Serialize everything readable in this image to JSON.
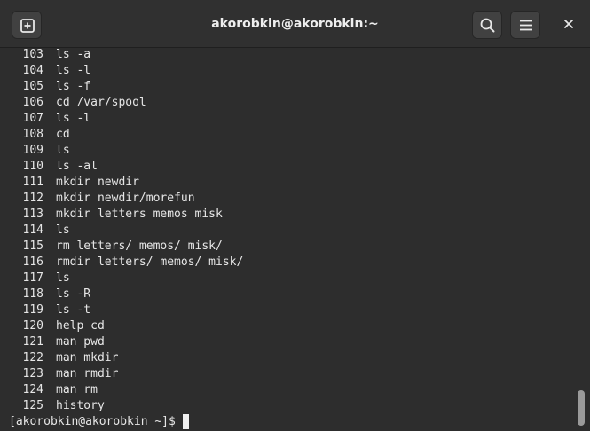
{
  "window": {
    "title": "akorobkin@akorobkin:~"
  },
  "header": {
    "new_tab_icon": "plus-square-icon",
    "search_icon": "search-icon",
    "menu_icon": "hamburger-menu-icon",
    "close_icon": "close-icon"
  },
  "history": [
    {
      "num": "103",
      "cmd": "ls -a"
    },
    {
      "num": "104",
      "cmd": "ls -l"
    },
    {
      "num": "105",
      "cmd": "ls -f"
    },
    {
      "num": "106",
      "cmd": "cd /var/spool"
    },
    {
      "num": "107",
      "cmd": "ls -l"
    },
    {
      "num": "108",
      "cmd": "cd"
    },
    {
      "num": "109",
      "cmd": "ls"
    },
    {
      "num": "110",
      "cmd": "ls -al"
    },
    {
      "num": "111",
      "cmd": "mkdir newdir"
    },
    {
      "num": "112",
      "cmd": "mkdir newdir/morefun"
    },
    {
      "num": "113",
      "cmd": "mkdir letters memos misk"
    },
    {
      "num": "114",
      "cmd": "ls"
    },
    {
      "num": "115",
      "cmd": "rm letters/ memos/ misk/"
    },
    {
      "num": "116",
      "cmd": "rmdir letters/ memos/ misk/"
    },
    {
      "num": "117",
      "cmd": "ls"
    },
    {
      "num": "118",
      "cmd": "ls -R"
    },
    {
      "num": "119",
      "cmd": "ls -t"
    },
    {
      "num": "120",
      "cmd": "help cd"
    },
    {
      "num": "121",
      "cmd": "man pwd"
    },
    {
      "num": "122",
      "cmd": "man mkdir"
    },
    {
      "num": "123",
      "cmd": "man rmdir"
    },
    {
      "num": "124",
      "cmd": "man rm"
    },
    {
      "num": "125",
      "cmd": "history"
    }
  ],
  "prompt": "[akorobkin@akorobkin ~]$",
  "colors": {
    "terminal_bg": "#2d2d2d",
    "terminal_fg": "#e6e6e6",
    "header_bg": "#303030"
  }
}
